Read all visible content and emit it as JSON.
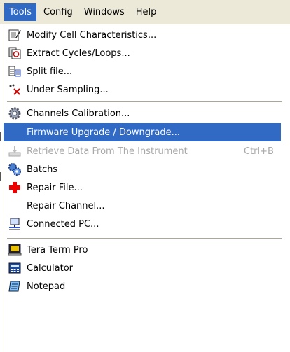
{
  "menubar": {
    "items": [
      {
        "label": "Tools"
      },
      {
        "label": "Config"
      },
      {
        "label": "Windows"
      },
      {
        "label": "Help"
      }
    ]
  },
  "menu": {
    "items": [
      {
        "label": "Modify Cell Characteristics...",
        "icon": "edit-cell-icon"
      },
      {
        "label": "Extract Cycles/Loops...",
        "icon": "extract-icon"
      },
      {
        "label": "Split file...",
        "icon": "split-file-icon"
      },
      {
        "label": "Under Sampling...",
        "icon": "under-sampling-icon"
      },
      {
        "label": "Channels Calibration...",
        "icon": "gear-icon"
      },
      {
        "label": "Firmware Upgrade / Downgrade...",
        "icon": ""
      },
      {
        "label": "Retrieve Data From The Instrument",
        "icon": "retrieve-icon",
        "shortcut": "Ctrl+B"
      },
      {
        "label": "Batchs",
        "icon": "batch-icon"
      },
      {
        "label": "Repair File...",
        "icon": "red-cross-icon"
      },
      {
        "label": "Repair Channel...",
        "icon": ""
      },
      {
        "label": "Connected PC...",
        "icon": "network-pc-icon"
      },
      {
        "label": "Tera Term Pro",
        "icon": "terminal-icon"
      },
      {
        "label": "Calculator",
        "icon": "calculator-icon"
      },
      {
        "label": "Notepad",
        "icon": "notepad-icon"
      }
    ]
  },
  "colors": {
    "menubar_bg": "#ece9d8",
    "highlight": "#316ac5",
    "disabled_text": "#a9a9a9",
    "separator": "#aca899"
  }
}
